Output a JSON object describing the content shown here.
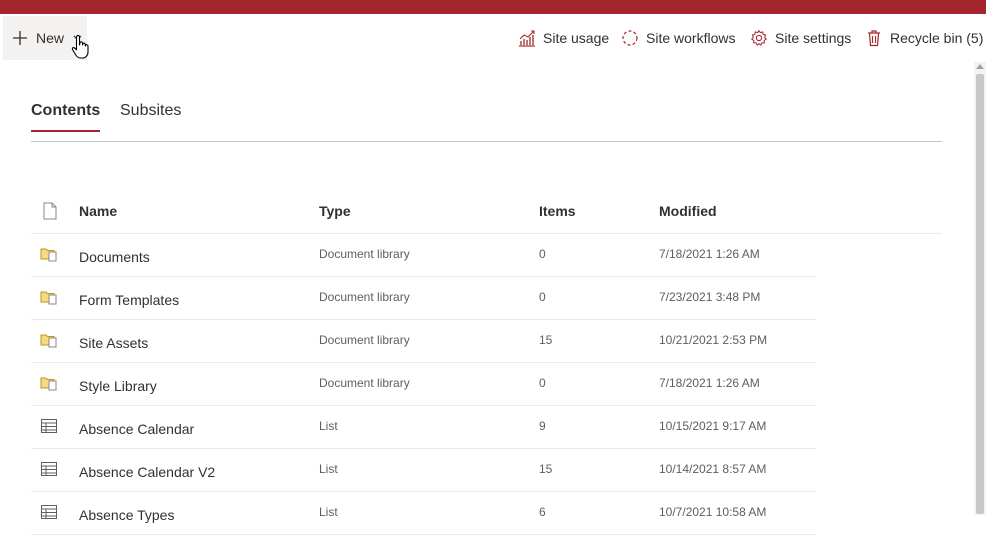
{
  "command_bar": {
    "new_label": "New",
    "site_usage": "Site usage",
    "site_workflows": "Site workflows",
    "site_settings": "Site settings",
    "recycle_bin": "Recycle bin (5)"
  },
  "tabs": [
    {
      "label": "Contents",
      "selected": true
    },
    {
      "label": "Subsites",
      "selected": false
    }
  ],
  "table": {
    "columns": {
      "name": "Name",
      "type": "Type",
      "items": "Items",
      "modified": "Modified"
    },
    "rows": [
      {
        "icon": "document-library-icon",
        "name": "Documents",
        "type": "Document library",
        "items": "0",
        "modified": "7/18/2021 1:26 AM"
      },
      {
        "icon": "document-library-icon",
        "name": "Form Templates",
        "type": "Document library",
        "items": "0",
        "modified": "7/23/2021 3:48 PM"
      },
      {
        "icon": "document-library-icon",
        "name": "Site Assets",
        "type": "Document library",
        "items": "15",
        "modified": "10/21/2021 2:53 PM"
      },
      {
        "icon": "document-library-icon",
        "name": "Style Library",
        "type": "Document library",
        "items": "0",
        "modified": "7/18/2021 1:26 AM"
      },
      {
        "icon": "list-icon",
        "name": "Absence Calendar",
        "type": "List",
        "items": "9",
        "modified": "10/15/2021 9:17 AM"
      },
      {
        "icon": "list-icon",
        "name": "Absence Calendar V2",
        "type": "List",
        "items": "15",
        "modified": "10/14/2021 8:57 AM"
      },
      {
        "icon": "list-icon",
        "name": "Absence Types",
        "type": "List",
        "items": "6",
        "modified": "10/7/2021 10:58 AM"
      }
    ]
  },
  "colors": {
    "brand": "#a4262c",
    "text": "#323130",
    "secondary_text": "#605e5c",
    "library_icon": "#c19c00"
  }
}
